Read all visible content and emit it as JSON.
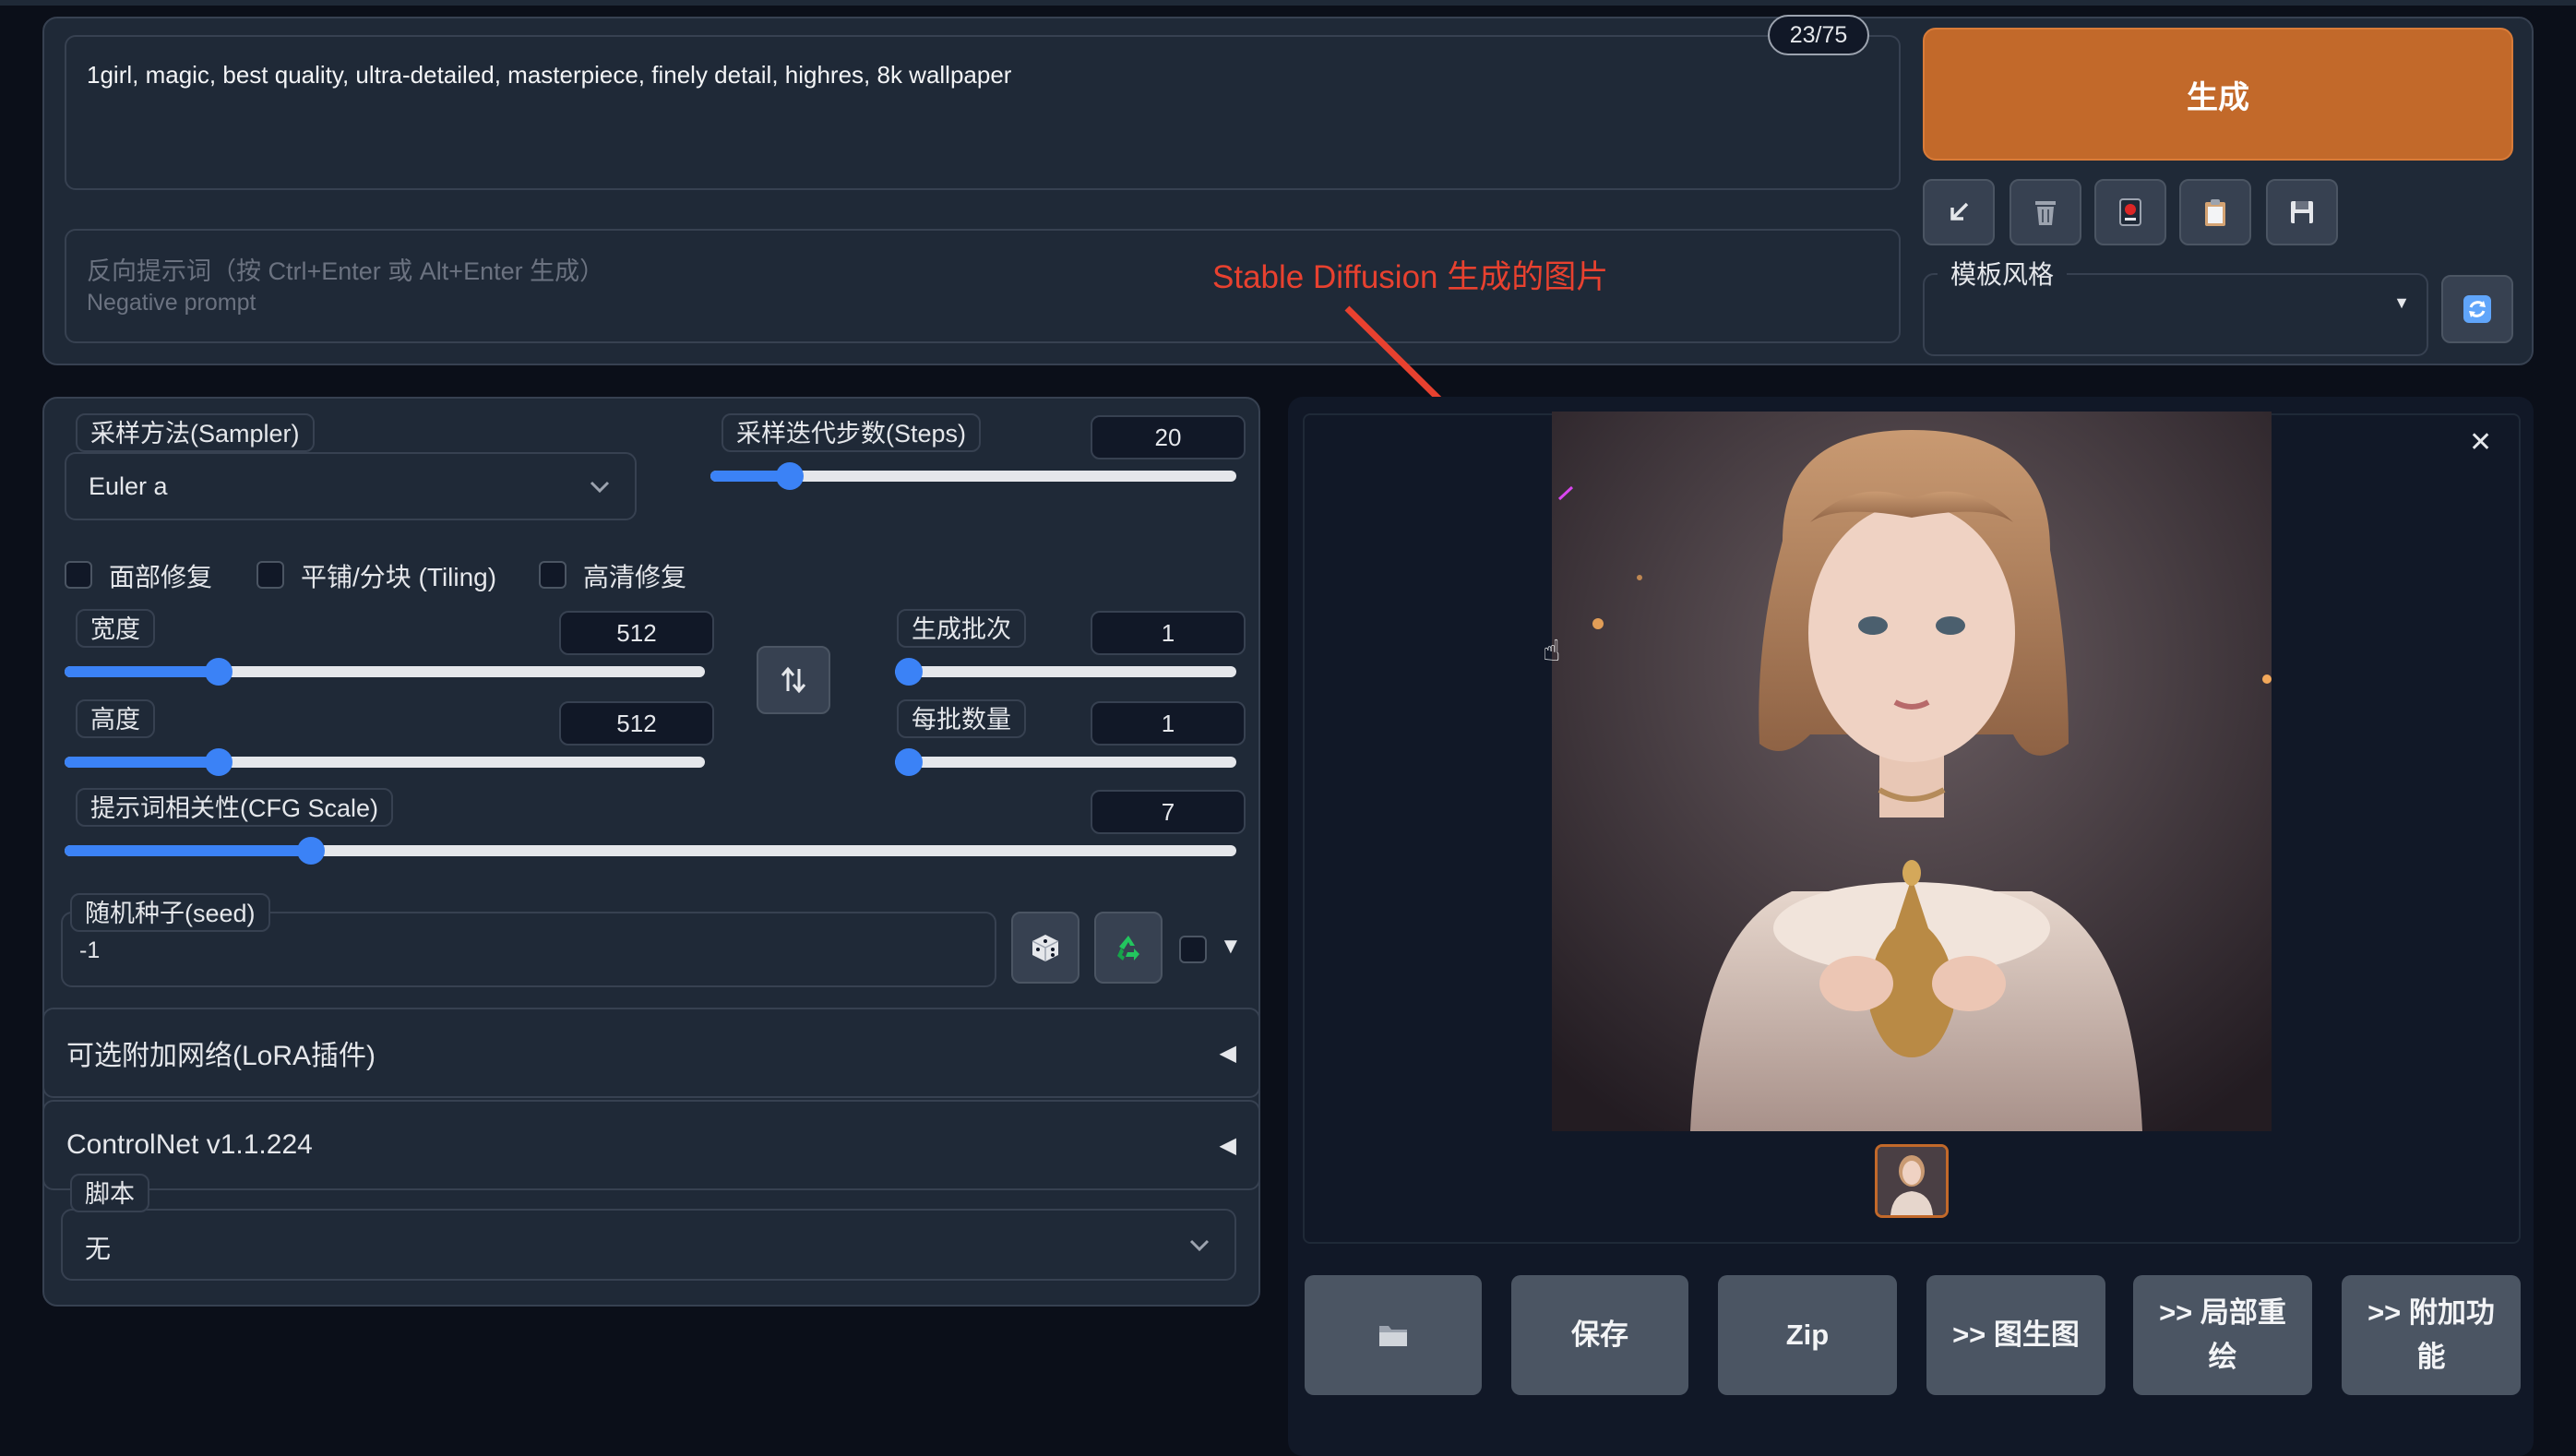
{
  "prompt": {
    "text": "1girl, magic, best quality, ultra-detailed, masterpiece, finely detail, highres, 8k wallpaper",
    "token_count": "23/75",
    "negative_placeholder_line1": "反向提示词（按 Ctrl+Enter 或 Alt+Enter 生成）",
    "negative_placeholder_line2": "Negative prompt"
  },
  "generate_button": "生成",
  "style": {
    "label": "模板风格"
  },
  "annotation": "Stable Diffusion 生成的图片",
  "sampler": {
    "label": "采样方法(Sampler)",
    "value": "Euler a"
  },
  "steps": {
    "label": "采样迭代步数(Steps)",
    "value": "20",
    "fraction": 0.15
  },
  "checkboxes": [
    "面部修复",
    "平铺/分块 (Tiling)",
    "高清修复"
  ],
  "width": {
    "label": "宽度",
    "value": "512",
    "fraction": 0.24
  },
  "height": {
    "label": "高度",
    "value": "512",
    "fraction": 0.24
  },
  "batch_count": {
    "label": "生成批次",
    "value": "1",
    "fraction": 0.0
  },
  "batch_size": {
    "label": "每批数量",
    "value": "1",
    "fraction": 0.0
  },
  "cfg": {
    "label": "提示词相关性(CFG Scale)",
    "value": "7",
    "fraction": 0.21
  },
  "seed": {
    "label": "随机种子(seed)",
    "value": "-1"
  },
  "lora": {
    "label": "可选附加网络(LoRA插件)"
  },
  "controlnet": {
    "label": "ControlNet v1.1.224"
  },
  "script": {
    "label": "脚本",
    "value": "无"
  },
  "output_buttons": {
    "save": "保存",
    "zip": "Zip",
    "img2img": ">> 图生图",
    "inpaint_line1": ">> 局部重",
    "inpaint_line2": "绘",
    "extras_line1": ">> 附加功",
    "extras_line2": "能"
  },
  "icons": {
    "arrow": "arrow-down-left-icon",
    "trash": "trash-icon",
    "style_apply": "red-card-icon",
    "clipboard": "clipboard-icon",
    "save": "floppy-disk-icon",
    "refresh": "refresh-icon",
    "swap": "swap-icon",
    "dice": "dice-icon",
    "recycle": "recycle-icon",
    "folder": "folder-icon",
    "close": "close-icon"
  },
  "colors": {
    "accent": "#c2692a",
    "slider": "#3b82f6",
    "annotation": "#e8412f",
    "background": "#0b0f19",
    "panel": "#1f2937"
  }
}
